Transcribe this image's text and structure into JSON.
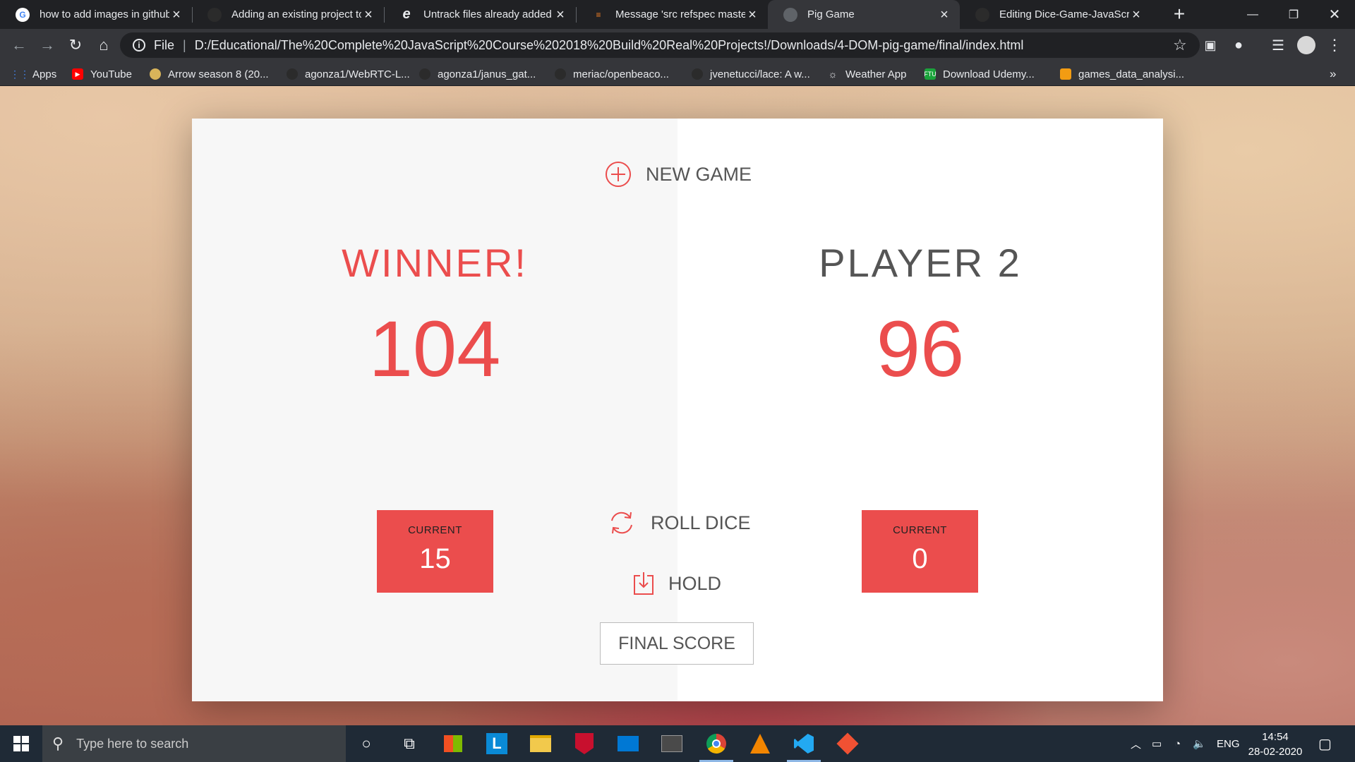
{
  "browser": {
    "tabs": [
      {
        "title": "how to add images in github",
        "icon": "google-icon",
        "active": false
      },
      {
        "title": "Adding an existing project to",
        "icon": "github-icon",
        "active": false
      },
      {
        "title": "Untrack files already added t",
        "icon": "edge-icon",
        "active": false
      },
      {
        "title": "Message 'src refspec master",
        "icon": "stackoverflow-icon",
        "active": false
      },
      {
        "title": "Pig Game",
        "icon": "globe-icon",
        "active": true
      },
      {
        "title": "Editing Dice-Game-JavaScrip",
        "icon": "github-icon",
        "active": false
      }
    ],
    "address": {
      "scheme_label": "File",
      "url": "D:/Educational/The%20Complete%20JavaScript%20Course%202018%20Build%20Real%20Projects!/Downloads/4-DOM-pig-game/final/index.html"
    },
    "bookmarks": [
      {
        "label": "Apps",
        "icon": "apps-grid-icon"
      },
      {
        "label": "YouTube",
        "icon": "youtube-icon"
      },
      {
        "label": "Arrow season 8 (20...",
        "icon": "arrow-site-icon"
      },
      {
        "label": "agonza1/WebRTC-L...",
        "icon": "github-icon"
      },
      {
        "label": "agonza1/janus_gat...",
        "icon": "github-icon"
      },
      {
        "label": "meriac/openbeaco...",
        "icon": "github-icon"
      },
      {
        "label": "jvenetucci/lace: A w...",
        "icon": "github-icon"
      },
      {
        "label": "Weather App",
        "icon": "weather-icon"
      },
      {
        "label": "Download Udemy...",
        "icon": "ftu-icon"
      },
      {
        "label": "games_data_analysi...",
        "icon": "notebook-icon"
      }
    ],
    "bookmarks_overflow": "»"
  },
  "game": {
    "new_game_label": "NEW GAME",
    "roll_dice_label": "ROLL DICE",
    "hold_label": "HOLD",
    "final_score_placeholder": "FINAL SCORE",
    "players": [
      {
        "name": "WINNER!",
        "score": "104",
        "current_label": "CURRENT",
        "current": "15",
        "is_winner": true
      },
      {
        "name": "PLAYER 2",
        "score": "96",
        "current_label": "CURRENT",
        "current": "0",
        "is_winner": false
      }
    ],
    "accent_color": "#eb4d4d"
  },
  "taskbar": {
    "search_placeholder": "Type here to search",
    "language": "ENG",
    "time": "14:54",
    "date": "28-02-2020"
  }
}
